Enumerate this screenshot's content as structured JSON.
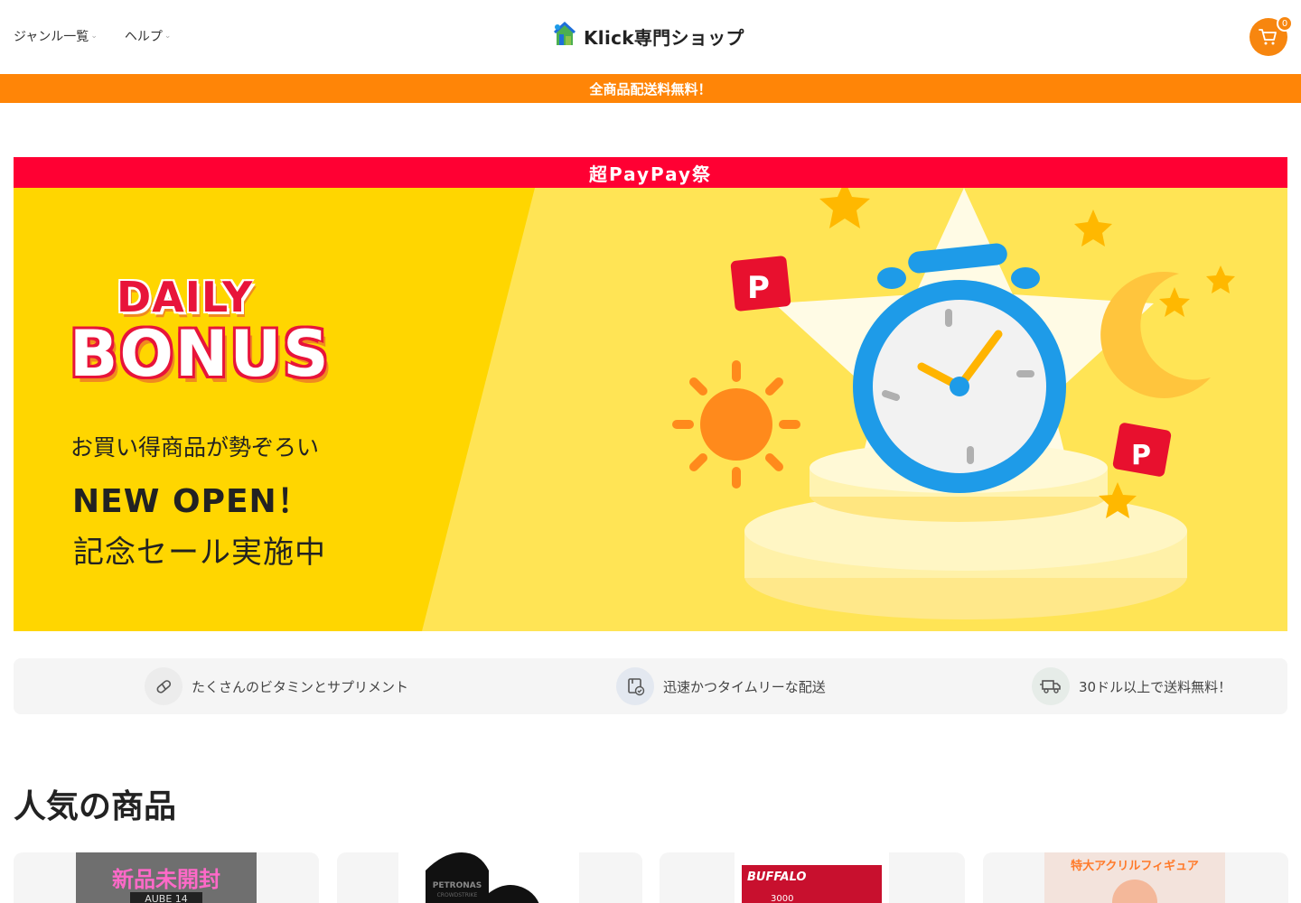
{
  "header": {
    "nav": [
      {
        "label": "ジャンル一覧"
      },
      {
        "label": "ヘルプ"
      }
    ],
    "brand_name": "Klick専門ショップ",
    "cart_count": "0",
    "icons": {
      "cart": "shopping-cart-icon",
      "chevron": "chevron-down-icon"
    }
  },
  "announcement": "全商品配送料無料！",
  "banner": {
    "top_label": "超PayPay祭",
    "daily": "DAILY",
    "bonus": "BONUS",
    "line1": "お買い得商品が勢ぞろい",
    "line2": "NEW OPEN！",
    "line3": "記念セール実施中",
    "colors": {
      "yellow": "#ffd700",
      "red": "#ff0033",
      "orange": "#f08a1f",
      "clock_blue": "#1e9be8"
    }
  },
  "features": [
    {
      "label": "たくさんのビタミンとサプリメント",
      "icon": "pill-icon"
    },
    {
      "label": "迅速かつタイムリーな配送",
      "icon": "package-check-icon"
    },
    {
      "label": "30ドル以上で送料無料！",
      "icon": "delivery-truck-icon"
    }
  ],
  "popular": {
    "title": "人気の商品",
    "products": [
      {
        "image_text": "新品未開封",
        "sub_text": "AUBE 14"
      },
      {
        "image_text": "PETRONAS",
        "sub_text": "CROWDSTRIKE"
      },
      {
        "image_text": "BUFFALO",
        "sub_text": "3000"
      },
      {
        "image_text": "特大アクリルフィギュア",
        "sub_text": ""
      }
    ]
  },
  "accent_color": "#f7860f"
}
